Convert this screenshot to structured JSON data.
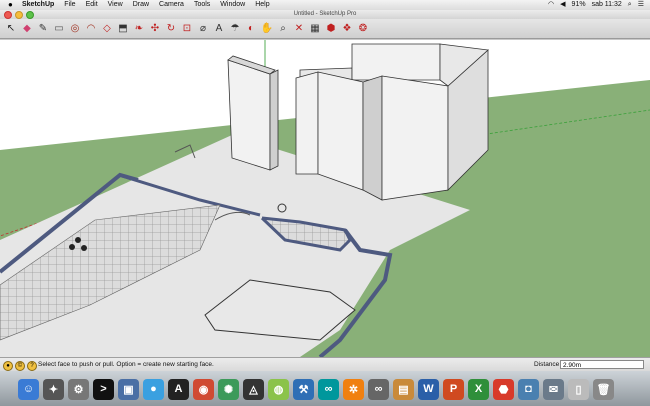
{
  "menubar": {
    "apple": "",
    "menus": [
      "SketchUp",
      "File",
      "Edit",
      "View",
      "Draw",
      "Camera",
      "Tools",
      "Window",
      "Help"
    ],
    "battery": "91%",
    "clock": "sab 11:32"
  },
  "window": {
    "title": "Untitled - SketchUp Pro"
  },
  "toolbar": {
    "tools": [
      {
        "icon": "select-arrow-icon",
        "glyph": "↖",
        "color": "#222222"
      },
      {
        "icon": "eraser-icon",
        "glyph": "◆",
        "color": "#d04070"
      },
      {
        "icon": "pencil-icon",
        "glyph": "✎",
        "color": "#333333"
      },
      {
        "icon": "rectangle-icon",
        "glyph": "▭",
        "color": "#555555"
      },
      {
        "icon": "circle-icon",
        "glyph": "◎",
        "color": "#a03020"
      },
      {
        "icon": "arc-icon",
        "glyph": "◠",
        "color": "#a03020"
      },
      {
        "icon": "shape-icon",
        "glyph": "◇",
        "color": "#c02020"
      },
      {
        "icon": "push-pull-icon",
        "glyph": "⬒",
        "color": "#333333"
      },
      {
        "icon": "offset-icon",
        "glyph": "❧",
        "color": "#c02020"
      },
      {
        "icon": "move-icon",
        "glyph": "✣",
        "color": "#c02020"
      },
      {
        "icon": "rotate-icon",
        "glyph": "↻",
        "color": "#c02020"
      },
      {
        "icon": "scale-icon",
        "glyph": "⊡",
        "color": "#c02020"
      },
      {
        "icon": "tape-measure-icon",
        "glyph": "⌀",
        "color": "#333333"
      },
      {
        "icon": "text-icon",
        "glyph": "A",
        "color": "#333333"
      },
      {
        "icon": "paint-bucket-icon",
        "glyph": "☂",
        "color": "#333333"
      },
      {
        "icon": "orbit-icon",
        "glyph": "◐",
        "color": "#c02020"
      },
      {
        "icon": "pan-icon",
        "glyph": "✋",
        "color": "#333333"
      },
      {
        "icon": "zoom-icon",
        "glyph": "⌕",
        "color": "#333333"
      },
      {
        "icon": "zoom-extents-icon",
        "glyph": "✕",
        "color": "#c02020"
      },
      {
        "icon": "warehouse-icon",
        "glyph": "▦",
        "color": "#333333"
      },
      {
        "icon": "extension-icon",
        "glyph": "⬢",
        "color": "#c02020"
      },
      {
        "icon": "components-icon",
        "glyph": "❖",
        "color": "#c02020"
      },
      {
        "icon": "styles-icon",
        "glyph": "❂",
        "color": "#c02020"
      }
    ]
  },
  "statusbar": {
    "hint": "Select face to push or pull.  Option = create new starting face.",
    "distance_label": "Distance",
    "distance_value": "2.90m"
  },
  "dock": {
    "apps": [
      {
        "icon": "finder-icon",
        "glyph": "☺",
        "color": "#3a7bd5"
      },
      {
        "icon": "launchpad-icon",
        "glyph": "✦",
        "color": "#555555"
      },
      {
        "icon": "system-preferences-icon",
        "glyph": "⚙",
        "color": "#777777"
      },
      {
        "icon": "terminal-icon",
        "glyph": ">",
        "color": "#111111"
      },
      {
        "icon": "preview-icon",
        "glyph": "▣",
        "color": "#4a6fa5"
      },
      {
        "icon": "messages-icon",
        "glyph": "●",
        "color": "#3aa0e0"
      },
      {
        "icon": "app-store-icon",
        "glyph": "A",
        "color": "#222222"
      },
      {
        "icon": "chrome-icon",
        "glyph": "◉",
        "color": "#d04a32"
      },
      {
        "icon": "android-studio-icon",
        "glyph": "✺",
        "color": "#3c9a5a"
      },
      {
        "icon": "unity-icon",
        "glyph": "◬",
        "color": "#333333"
      },
      {
        "icon": "android-file-transfer-icon",
        "glyph": "◍",
        "color": "#8bc34a"
      },
      {
        "icon": "xcode-icon",
        "glyph": "⚒",
        "color": "#2f6fb5"
      },
      {
        "icon": "arduino-icon",
        "glyph": "∞",
        "color": "#00979c"
      },
      {
        "icon": "vlc-icon",
        "glyph": "✲",
        "color": "#f08010"
      },
      {
        "icon": "glasses-icon",
        "glyph": "∞",
        "color": "#666666"
      },
      {
        "icon": "notes-icon",
        "glyph": "▤",
        "color": "#c98a3a"
      },
      {
        "icon": "word-icon",
        "glyph": "W",
        "color": "#2a5fa8"
      },
      {
        "icon": "powerpoint-icon",
        "glyph": "P",
        "color": "#d04a20"
      },
      {
        "icon": "excel-icon",
        "glyph": "X",
        "color": "#2f8f3a"
      },
      {
        "icon": "sketchup-icon",
        "glyph": "⬣",
        "color": "#d83a2a"
      },
      {
        "icon": "iphoto-icon",
        "glyph": "◘",
        "color": "#4a80b0"
      },
      {
        "icon": "mail-icon",
        "glyph": "✉",
        "color": "#6a7a8a"
      },
      {
        "icon": "document-icon",
        "glyph": "▯",
        "color": "#bbbbbb"
      },
      {
        "icon": "trash-icon",
        "glyph": "🗑",
        "color": "#888888"
      }
    ]
  },
  "colors": {
    "sky": "#ffffff",
    "ground": "#89b078",
    "floor": "#e6e6e6",
    "wall": "#f2f2f2",
    "wall_outline": "#4e5a80"
  }
}
